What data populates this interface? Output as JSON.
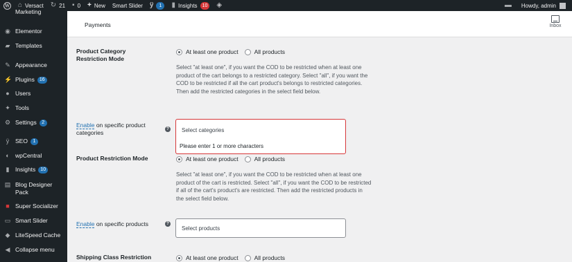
{
  "adminbar": {
    "site_name": "Versact",
    "updates_count": "21",
    "comments_count": "0",
    "new_label": "New",
    "smart_slider_label": "Smart Slider",
    "yoast_count": "1",
    "insights_label": "Insights",
    "insights_count": "10",
    "howdy": "Howdy, admin"
  },
  "sidebar": {
    "items": [
      {
        "label": "Marketing"
      },
      {
        "label": "Elementor"
      },
      {
        "label": "Templates"
      },
      {
        "label": "Appearance"
      },
      {
        "label": "Plugins",
        "badge": "16"
      },
      {
        "label": "Users"
      },
      {
        "label": "Tools"
      },
      {
        "label": "Settings",
        "badge": "2"
      },
      {
        "label": "SEO",
        "badge": "1"
      },
      {
        "label": "wpCentral"
      },
      {
        "label": "Insights",
        "badge": "10"
      },
      {
        "label": "Blog Designer Pack"
      },
      {
        "label": "Super Socializer"
      },
      {
        "label": "Smart Slider"
      },
      {
        "label": "LiteSpeed Cache"
      },
      {
        "label": "Collapse menu"
      }
    ]
  },
  "header": {
    "title": "Payments",
    "inbox_label": "Inbox"
  },
  "settings": {
    "category_mode": {
      "label": "Product Category Restriction Mode",
      "opt1": "At least one product",
      "opt2": "All products",
      "desc": "Select \"at least one\", if you want the COD to be restricted when at least one product of the cart belongs to a restricted category. Select \"all\", if you want the COD to be restricted if all the cart product's belongs to restricted categories. Then add the restricted categories in the select field below."
    },
    "category_enable": {
      "enable": "Enable",
      "rest": " on specific product categories",
      "placeholder": "Select categories",
      "hint": "Please enter 1 or more characters"
    },
    "product_mode": {
      "label": "Product Restriction Mode",
      "opt1": "At least one product",
      "opt2": "All products",
      "desc": "Select \"at least one\", if you want the COD to be restricted when at least one product of the cart is restricted. Select \"all\", if you want the COD to be restricted if all of the cart's product's are restricted. Then add the restricted products in the select field below."
    },
    "product_enable": {
      "enable": "Enable",
      "rest": " on specific products",
      "placeholder": "Select products"
    },
    "shipping_mode": {
      "label": "Shipping Class Restriction",
      "opt1": "At least one product",
      "opt2": "All products"
    }
  }
}
